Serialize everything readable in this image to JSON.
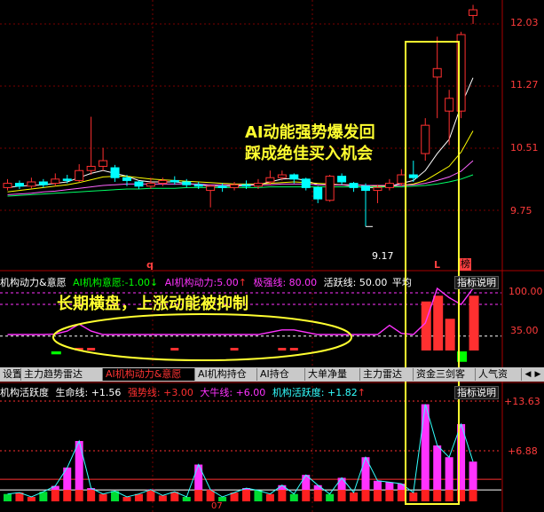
{
  "main_chart": {
    "price_axis": [
      "12.03",
      "11.27",
      "10.51",
      "9.75"
    ],
    "low_marker": "9.17",
    "markers": {
      "q": "q",
      "l": "L",
      "bang": "榜"
    }
  },
  "annotations": {
    "ai_line1": "AI动能强势爆发回",
    "ai_line2": "踩成绝佳买入机会",
    "consolidation": "长期横盘，上涨动能被抑制"
  },
  "panel1": {
    "title": "机构动力&意愿",
    "ai_will_label": "AI机构意愿:",
    "ai_will_value": "-1.00",
    "ai_power_label": "AI机构动力:",
    "ai_power_value": "5.00",
    "strong_label": "极强线:",
    "strong_value": "80.00",
    "active_label": "活跃线:",
    "active_value": "50.00",
    "trailing": "平均",
    "explain": "指标说明",
    "axis": [
      "100.00",
      "35.00"
    ]
  },
  "tabs": {
    "items": [
      "设置",
      "主力趋势雷达",
      "AI机构动力&意愿",
      "AI机构持仓",
      "AI持仓",
      "大单净量",
      "主力雷达",
      "资金三剑客",
      "人气资"
    ],
    "active_index": 2
  },
  "panel2": {
    "title": "机构活跃度",
    "life_label": "生命线:",
    "life_value": "+1.56",
    "strong_label": "强势线:",
    "strong_value": "+3.00",
    "bull_label": "大牛线:",
    "bull_value": "+6.00",
    "active_label": "机构活跃度:",
    "active_value": "+1.82",
    "explain": "指标说明",
    "axis": [
      "+13.63",
      "+6.88"
    ],
    "date_label": "07"
  },
  "colors": {
    "up": "#ff3030",
    "down": "#00ffff",
    "ai_power": "#ff33ff",
    "ai_will": "#00ff00",
    "highlight_box": "#ffff30",
    "grid": "#7a0000"
  },
  "candles": [
    {
      "o": 9.72,
      "c": 9.78,
      "h": 9.84,
      "l": 9.68
    },
    {
      "o": 9.78,
      "c": 9.74,
      "h": 9.82,
      "l": 9.7
    },
    {
      "o": 9.74,
      "c": 9.8,
      "h": 9.86,
      "l": 9.71
    },
    {
      "o": 9.8,
      "c": 9.76,
      "h": 9.84,
      "l": 9.72
    },
    {
      "o": 9.78,
      "c": 9.84,
      "h": 9.92,
      "l": 9.74
    },
    {
      "o": 9.84,
      "c": 9.82,
      "h": 9.9,
      "l": 9.78
    },
    {
      "o": 9.82,
      "c": 9.96,
      "h": 10.05,
      "l": 9.8
    },
    {
      "o": 9.96,
      "c": 10.02,
      "h": 10.72,
      "l": 9.9
    },
    {
      "o": 10.02,
      "c": 10.1,
      "h": 10.28,
      "l": 9.96
    },
    {
      "o": 10.0,
      "c": 9.86,
      "h": 10.04,
      "l": 9.8
    },
    {
      "o": 9.86,
      "c": 9.82,
      "h": 9.9,
      "l": 9.74
    },
    {
      "o": 9.8,
      "c": 9.74,
      "h": 9.82,
      "l": 9.7
    },
    {
      "o": 9.74,
      "c": 9.78,
      "h": 9.86,
      "l": 9.7
    },
    {
      "o": 9.78,
      "c": 9.82,
      "h": 9.86,
      "l": 9.74
    },
    {
      "o": 9.82,
      "c": 9.8,
      "h": 9.88,
      "l": 9.76
    },
    {
      "o": 9.8,
      "c": 9.76,
      "h": 9.84,
      "l": 9.72
    },
    {
      "o": 9.76,
      "c": 9.74,
      "h": 9.8,
      "l": 9.7
    },
    {
      "o": 9.68,
      "c": 9.74,
      "h": 9.76,
      "l": 9.44
    },
    {
      "o": 9.74,
      "c": 9.72,
      "h": 9.78,
      "l": 9.66
    },
    {
      "o": 9.72,
      "c": 9.76,
      "h": 9.8,
      "l": 9.68
    },
    {
      "o": 9.76,
      "c": 9.74,
      "h": 9.82,
      "l": 9.7
    },
    {
      "o": 9.74,
      "c": 9.78,
      "h": 9.84,
      "l": 9.7
    },
    {
      "o": 9.8,
      "c": 9.86,
      "h": 9.96,
      "l": 9.76
    },
    {
      "o": 9.86,
      "c": 9.9,
      "h": 9.96,
      "l": 9.82
    },
    {
      "o": 9.9,
      "c": 9.84,
      "h": 9.92,
      "l": 9.78
    },
    {
      "o": 9.84,
      "c": 9.72,
      "h": 9.86,
      "l": 9.68
    },
    {
      "o": 9.72,
      "c": 9.56,
      "h": 9.74,
      "l": 9.5
    },
    {
      "o": 9.54,
      "c": 9.88,
      "h": 9.9,
      "l": 9.52
    },
    {
      "o": 9.88,
      "c": 9.8,
      "h": 9.92,
      "l": 9.76
    },
    {
      "o": 9.78,
      "c": 9.72,
      "h": 9.8,
      "l": 9.66
    },
    {
      "o": 9.74,
      "c": 9.68,
      "h": 9.78,
      "l": 9.17
    },
    {
      "o": 9.68,
      "c": 9.72,
      "h": 9.76,
      "l": 9.5
    },
    {
      "o": 9.72,
      "c": 9.78,
      "h": 9.84,
      "l": 9.68
    },
    {
      "o": 9.78,
      "c": 9.9,
      "h": 9.98,
      "l": 9.74
    },
    {
      "o": 9.9,
      "c": 9.86,
      "h": 10.1,
      "l": 9.8
    },
    {
      "o": 10.2,
      "c": 10.6,
      "h": 10.7,
      "l": 10.1
    },
    {
      "o": 11.28,
      "c": 11.4,
      "h": 11.85,
      "l": 10.7
    },
    {
      "o": 10.8,
      "c": 10.98,
      "h": 11.1,
      "l": 10.32
    },
    {
      "o": 10.8,
      "c": 11.88,
      "h": 11.92,
      "l": 10.7
    },
    {
      "o": 12.15,
      "c": 12.23,
      "h": 12.3,
      "l": 12.03
    }
  ],
  "ma_lines": [
    {
      "color": "#ffffff",
      "values": [
        9.72,
        9.74,
        9.75,
        9.76,
        9.78,
        9.8,
        9.86,
        9.92,
        9.96,
        9.92,
        9.88,
        9.82,
        9.8,
        9.8,
        9.8,
        9.78,
        9.76,
        9.74,
        9.74,
        9.74,
        9.75,
        9.76,
        9.8,
        9.84,
        9.85,
        9.82,
        9.76,
        9.76,
        9.76,
        9.74,
        9.72,
        9.72,
        9.74,
        9.78,
        9.82,
        9.96,
        10.2,
        10.4,
        10.88,
        11.27
      ]
    },
    {
      "color": "#ffff00",
      "values": [
        9.66,
        9.68,
        9.7,
        9.72,
        9.74,
        9.76,
        9.79,
        9.83,
        9.87,
        9.88,
        9.88,
        9.86,
        9.84,
        9.83,
        9.82,
        9.81,
        9.8,
        9.79,
        9.78,
        9.77,
        9.77,
        9.77,
        9.78,
        9.79,
        9.8,
        9.79,
        9.78,
        9.77,
        9.76,
        9.76,
        9.75,
        9.74,
        9.74,
        9.75,
        9.77,
        9.82,
        9.92,
        10.02,
        10.22,
        10.52
      ]
    },
    {
      "color": "#ff66ff",
      "values": [
        9.62,
        9.63,
        9.64,
        9.66,
        9.67,
        9.69,
        9.71,
        9.73,
        9.75,
        9.76,
        9.77,
        9.77,
        9.77,
        9.77,
        9.77,
        9.77,
        9.77,
        9.76,
        9.76,
        9.76,
        9.76,
        9.76,
        9.76,
        9.77,
        9.77,
        9.77,
        9.76,
        9.76,
        9.76,
        9.76,
        9.75,
        9.75,
        9.75,
        9.75,
        9.76,
        9.78,
        9.82,
        9.87,
        9.95,
        10.1
      ]
    },
    {
      "color": "#00ff66",
      "values": [
        9.6,
        9.61,
        9.62,
        9.63,
        9.64,
        9.65,
        9.66,
        9.67,
        9.68,
        9.69,
        9.7,
        9.7,
        9.71,
        9.71,
        9.71,
        9.72,
        9.72,
        9.72,
        9.72,
        9.72,
        9.72,
        9.72,
        9.73,
        9.73,
        9.73,
        9.73,
        9.73,
        9.73,
        9.73,
        9.73,
        9.73,
        9.73,
        9.73,
        9.73,
        9.74,
        9.75,
        9.77,
        9.8,
        9.84,
        9.9
      ]
    }
  ],
  "ai_power": [
    20,
    20,
    20,
    20,
    21,
    26,
    38,
    26,
    20,
    20,
    20,
    20,
    20,
    20,
    20,
    20,
    20,
    20,
    20,
    20,
    20,
    20,
    24,
    28,
    28,
    24,
    20,
    20,
    20,
    20,
    20,
    20,
    36,
    22,
    20,
    40,
    100,
    84,
    72,
    100
  ],
  "ai_bars": [
    0,
    0,
    0,
    0,
    -2,
    0,
    5,
    5,
    0,
    0,
    0,
    0,
    0,
    0,
    4,
    0,
    0,
    0,
    0,
    3,
    0,
    0,
    0,
    3,
    4,
    0,
    0,
    0,
    0,
    0,
    0,
    0,
    0,
    0,
    0,
    0,
    60,
    30,
    -15,
    0
  ],
  "ai_bars_max": [
    0,
    0,
    0,
    0,
    0,
    0,
    0,
    0,
    0,
    0,
    0,
    0,
    0,
    0,
    0,
    0,
    0,
    0,
    0,
    0,
    0,
    0,
    0,
    0,
    0,
    0,
    0,
    0,
    0,
    0,
    0,
    0,
    0,
    0,
    0,
    85,
    95,
    55,
    0,
    95
  ],
  "activity": [
    {
      "v": 1.0,
      "r": 1.0
    },
    {
      "v": 1.2,
      "r": 1.2
    },
    {
      "v": 0.6,
      "r": 0.6
    },
    {
      "v": 1.3,
      "r": 1.3
    },
    {
      "v": 2.1,
      "r": 1.56
    },
    {
      "v": 4.6,
      "r": 1.56
    },
    {
      "v": 8.2,
      "r": 1.56
    },
    {
      "v": 1.8,
      "r": 1.56
    },
    {
      "v": 1.0,
      "r": 1.0
    },
    {
      "v": 1.4,
      "r": 1.4
    },
    {
      "v": 0.6,
      "r": 0.6
    },
    {
      "v": 1.0,
      "r": 1.0
    },
    {
      "v": 1.6,
      "r": 1.56
    },
    {
      "v": 0.8,
      "r": 0.8
    },
    {
      "v": 1.3,
      "r": 1.3
    },
    {
      "v": 0.6,
      "r": 0.6
    },
    {
      "v": 5.0,
      "r": 1.56
    },
    {
      "v": 1.6,
      "r": 1.56
    },
    {
      "v": 0.6,
      "r": 0.6
    },
    {
      "v": 1.2,
      "r": 1.2
    },
    {
      "v": 1.8,
      "r": 1.56
    },
    {
      "v": 1.5,
      "r": 1.5
    },
    {
      "v": 1.0,
      "r": 1.0
    },
    {
      "v": 2.2,
      "r": 1.56
    },
    {
      "v": 1.0,
      "r": 1.0
    },
    {
      "v": 3.6,
      "r": 1.56
    },
    {
      "v": 2.2,
      "r": 1.56
    },
    {
      "v": 1.0,
      "r": 1.0
    },
    {
      "v": 3.2,
      "r": 1.56
    },
    {
      "v": 1.2,
      "r": 1.2
    },
    {
      "v": 6.0,
      "r": 1.56
    },
    {
      "v": 2.8,
      "r": 1.56
    },
    {
      "v": 2.6,
      "r": 1.56
    },
    {
      "v": 2.4,
      "r": 1.56
    },
    {
      "v": 1.2,
      "r": 1.2
    },
    {
      "v": 13.2,
      "r": 1.56
    },
    {
      "v": 7.6,
      "r": 1.56
    },
    {
      "v": 6.0,
      "r": 1.56
    },
    {
      "v": 10.5,
      "r": 1.56
    },
    {
      "v": 5.4,
      "r": 1.56
    }
  ]
}
